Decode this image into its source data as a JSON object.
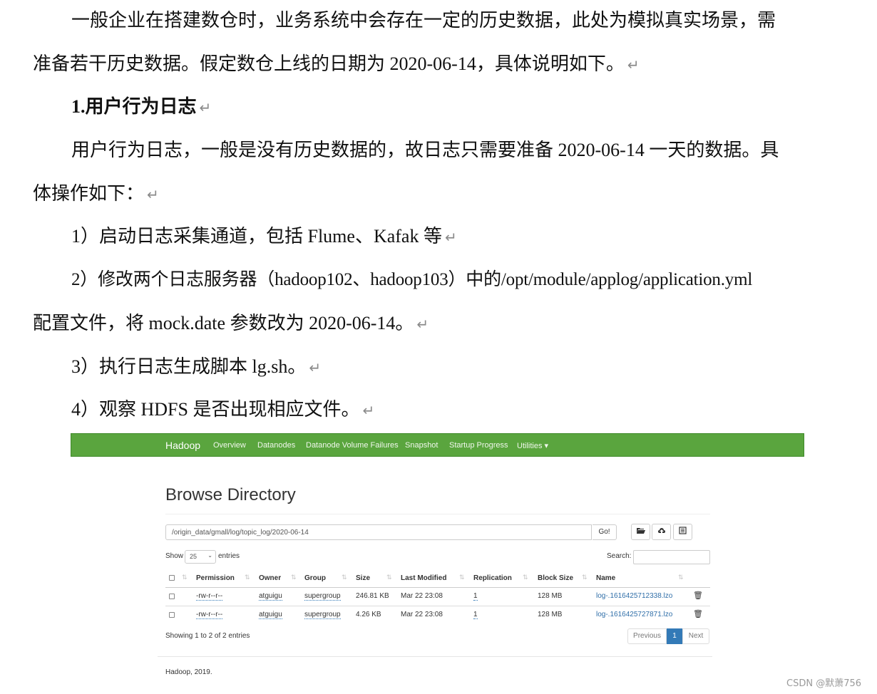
{
  "document": {
    "para1_line1": "一般企业在搭建数仓时，业务系统中会存在一定的历史数据，此处为模拟真实场景，需",
    "para1_line2": "准备若干历史数据。假定数仓上线的日期为 2020-06-14，具体说明如下。",
    "heading": "1.用户行为日志",
    "para2_line1": "用户行为日志，一般是没有历史数据的，故日志只需要准备 2020-06-14 一天的数据。具",
    "para2_line2": "体操作如下：",
    "step1": "1）启动日志采集通道，包括 Flume、Kafak 等",
    "step2_line1": "2）修改两个日志服务器（hadoop102、hadoop103）中的/opt/module/applog/application.yml",
    "step2_line2": "配置文件，将 mock.date 参数改为 2020-06-14。",
    "step3": "3）执行日志生成脚本 lg.sh。",
    "step4": "4）观察 HDFS 是否出现相应文件。",
    "return_mark": "↵"
  },
  "hadoop": {
    "brand": "Hadoop",
    "nav": [
      "Overview",
      "Datanodes",
      "Datanode Volume Failures",
      "Snapshot",
      "Startup Progress",
      "Utilities ▾"
    ],
    "page_title": "Browse Directory",
    "path_value": "/origin_data/gmall/log/topic_log/2020-06-14",
    "go_label": "Go!",
    "show_label": "Show",
    "entries_select": "25",
    "entries_label": "entries",
    "search_label": "Search:",
    "columns": [
      "Permission",
      "Owner",
      "Group",
      "Size",
      "Last Modified",
      "Replication",
      "Block Size",
      "Name"
    ],
    "rows": [
      {
        "permission": "-rw-r--r--",
        "owner": "atguigu",
        "group": "supergroup",
        "size": "246.81 KB",
        "modified": "Mar 22 23:08",
        "replication": "1",
        "block_size": "128 MB",
        "name": "log-.1616425712338.lzo"
      },
      {
        "permission": "-rw-r--r--",
        "owner": "atguigu",
        "group": "supergroup",
        "size": "4.26 KB",
        "modified": "Mar 22 23:08",
        "replication": "1",
        "block_size": "128 MB",
        "name": "log-.1616425727871.lzo"
      }
    ],
    "showing_text": "Showing 1 to 2 of 2 entries",
    "pagination": {
      "previous": "Previous",
      "current": "1",
      "next": "Next"
    },
    "footer": "Hadoop, 2019."
  },
  "watermark": "CSDN @默萧756",
  "colors": {
    "navbar": "#5aa53e",
    "link": "#2f6ea8",
    "active_page": "#337ab7"
  }
}
